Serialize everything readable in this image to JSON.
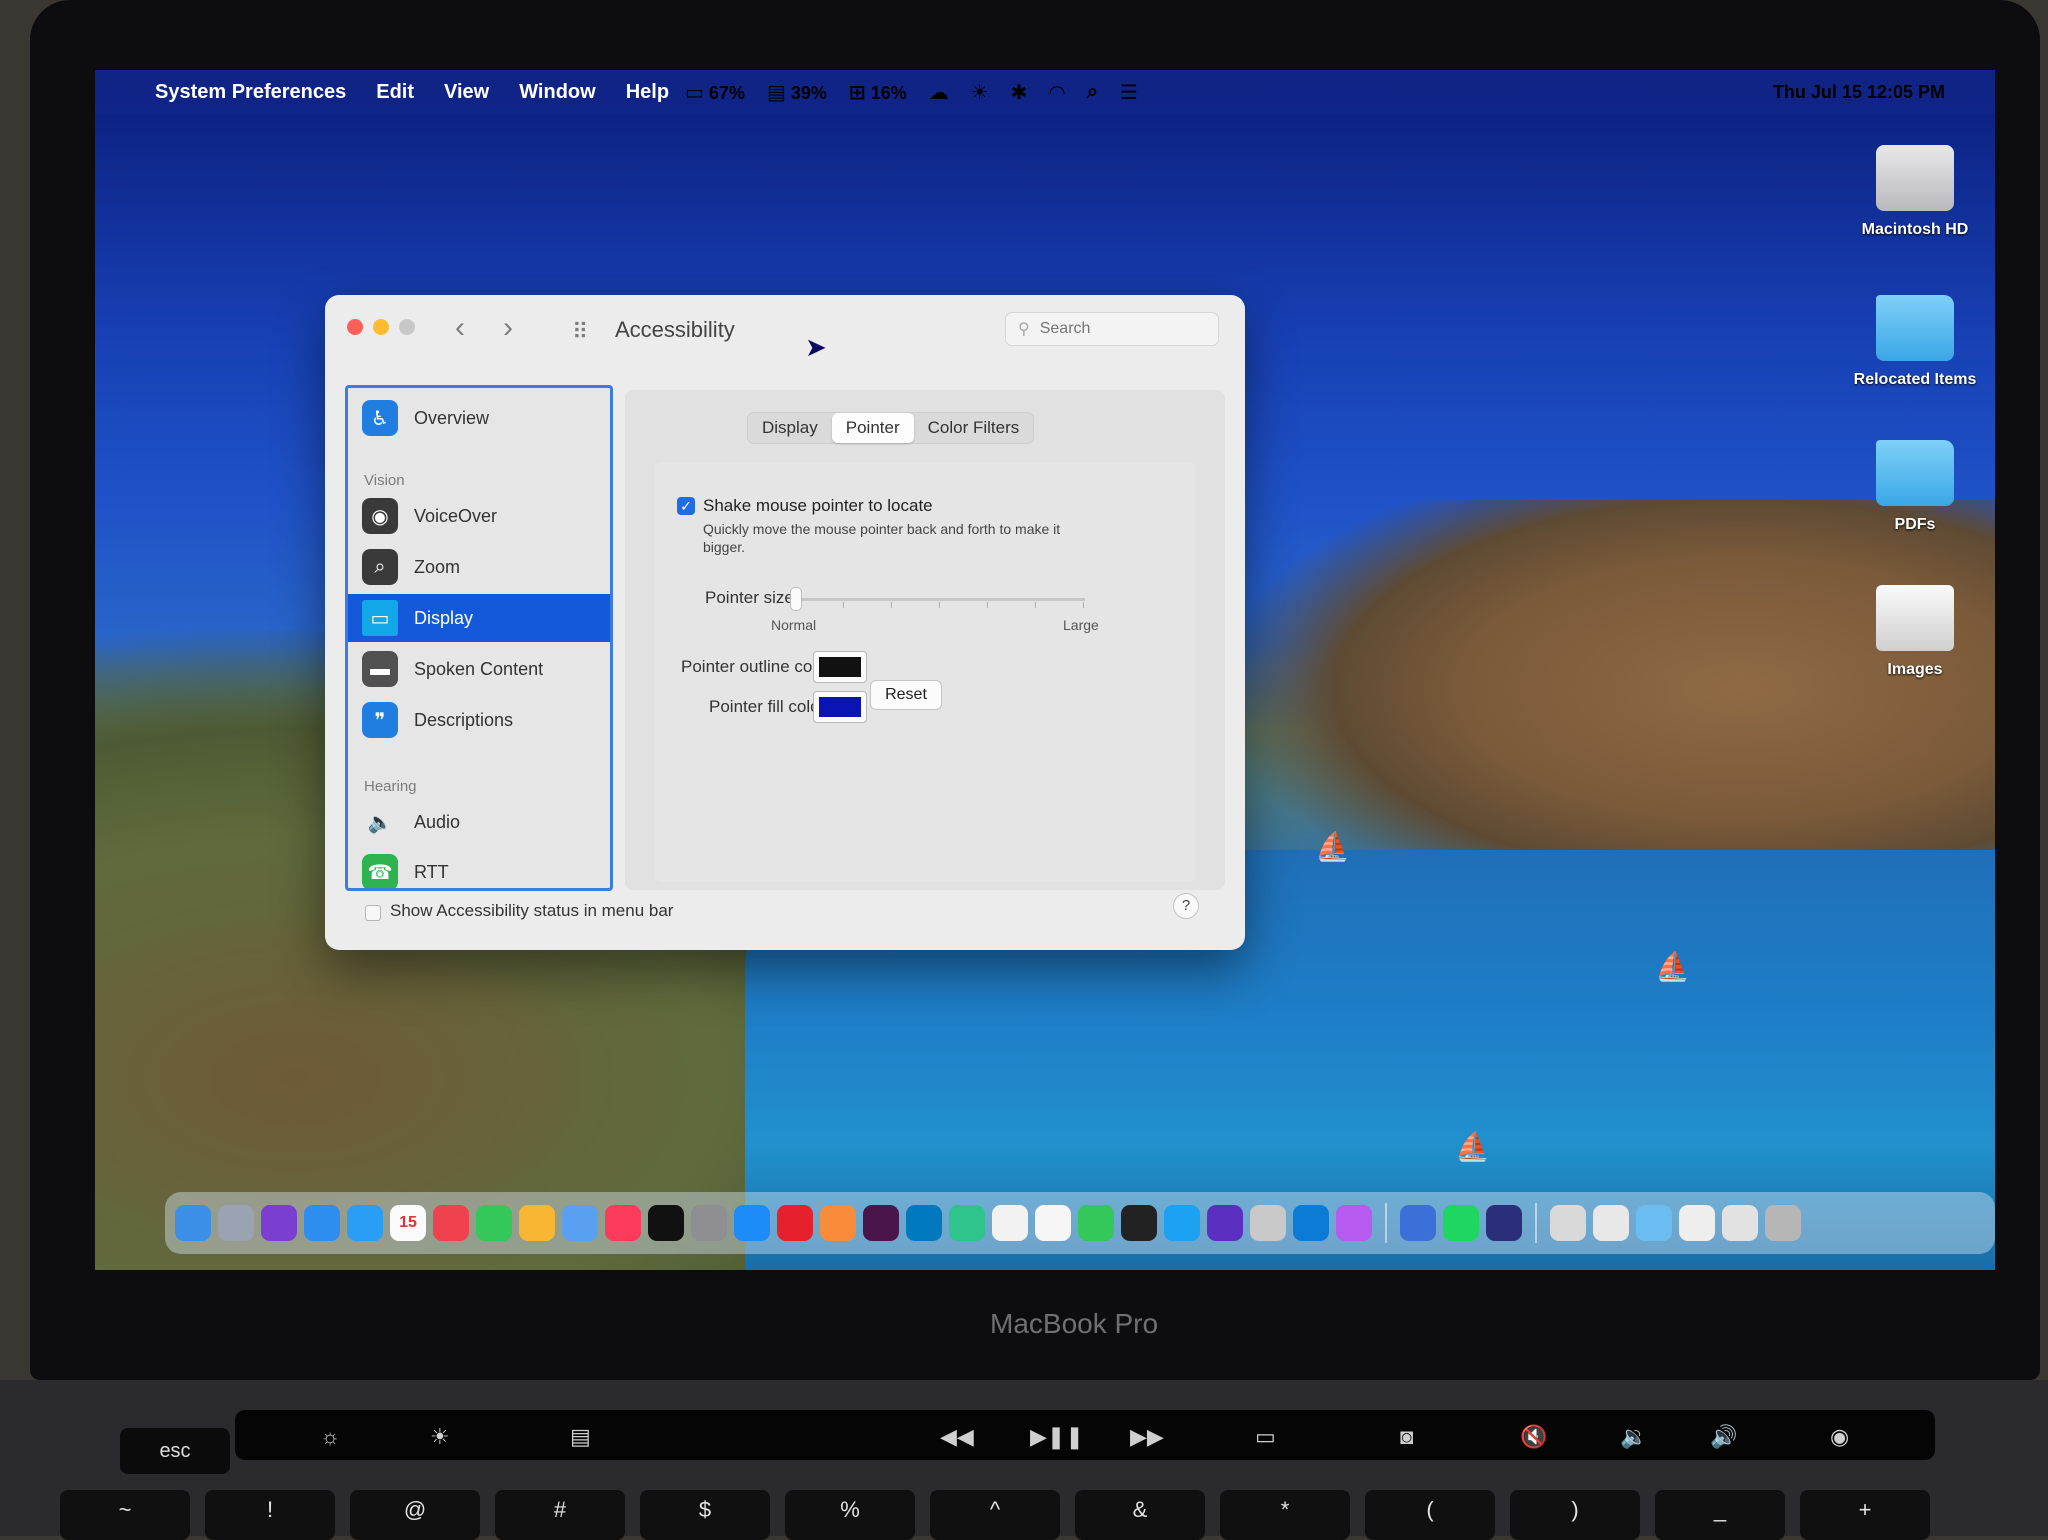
{
  "menubar": {
    "app_name": "System Preferences",
    "menus": [
      "Edit",
      "View",
      "Window",
      "Help"
    ],
    "status": [
      {
        "icon": "battery-icon",
        "glyph": "▭",
        "text": "67%"
      },
      {
        "icon": "memory-icon",
        "glyph": "▤",
        "text": "39%"
      },
      {
        "icon": "cpu-icon",
        "glyph": "⊞",
        "text": "16%"
      }
    ],
    "clock": "Thu Jul 15  12:05 PM"
  },
  "desktop": {
    "icons": [
      "Macintosh HD",
      "Relocated Items",
      "PDFs",
      "Images"
    ]
  },
  "window": {
    "title": "Accessibility",
    "search_placeholder": "Search",
    "sidebar": {
      "overview": "Overview",
      "section_vision": "Vision",
      "vision_items": [
        "VoiceOver",
        "Zoom",
        "Display",
        "Spoken Content",
        "Descriptions"
      ],
      "section_hearing": "Hearing",
      "hearing_items": [
        "Audio",
        "RTT"
      ],
      "selected": "Display"
    },
    "tabs": [
      "Display",
      "Pointer",
      "Color Filters"
    ],
    "active_tab": "Pointer",
    "pointer": {
      "shake_label": "Shake mouse pointer to locate",
      "shake_checked": true,
      "shake_help": "Quickly move the mouse pointer back and forth to make it bigger.",
      "size_label": "Pointer size:",
      "size_min_label": "Normal",
      "size_max_label": "Large",
      "size_value": 0,
      "outline_label": "Pointer outline color:",
      "outline_color": "#111111",
      "fill_label": "Pointer fill color:",
      "fill_color": "#0a14b4",
      "reset_label": "Reset"
    },
    "footer": {
      "status_checkbox_label": "Show Accessibility status in menu bar",
      "status_checked": false,
      "help_label": "?"
    }
  },
  "dock": {
    "calendar_day": "15"
  },
  "laptop": {
    "model_label": "MacBook Pro",
    "esc_label": "esc",
    "keys": [
      "~",
      "!",
      "@",
      "#",
      "$",
      "%",
      "^",
      "&",
      "*",
      "(",
      ")",
      "_",
      "+"
    ]
  }
}
